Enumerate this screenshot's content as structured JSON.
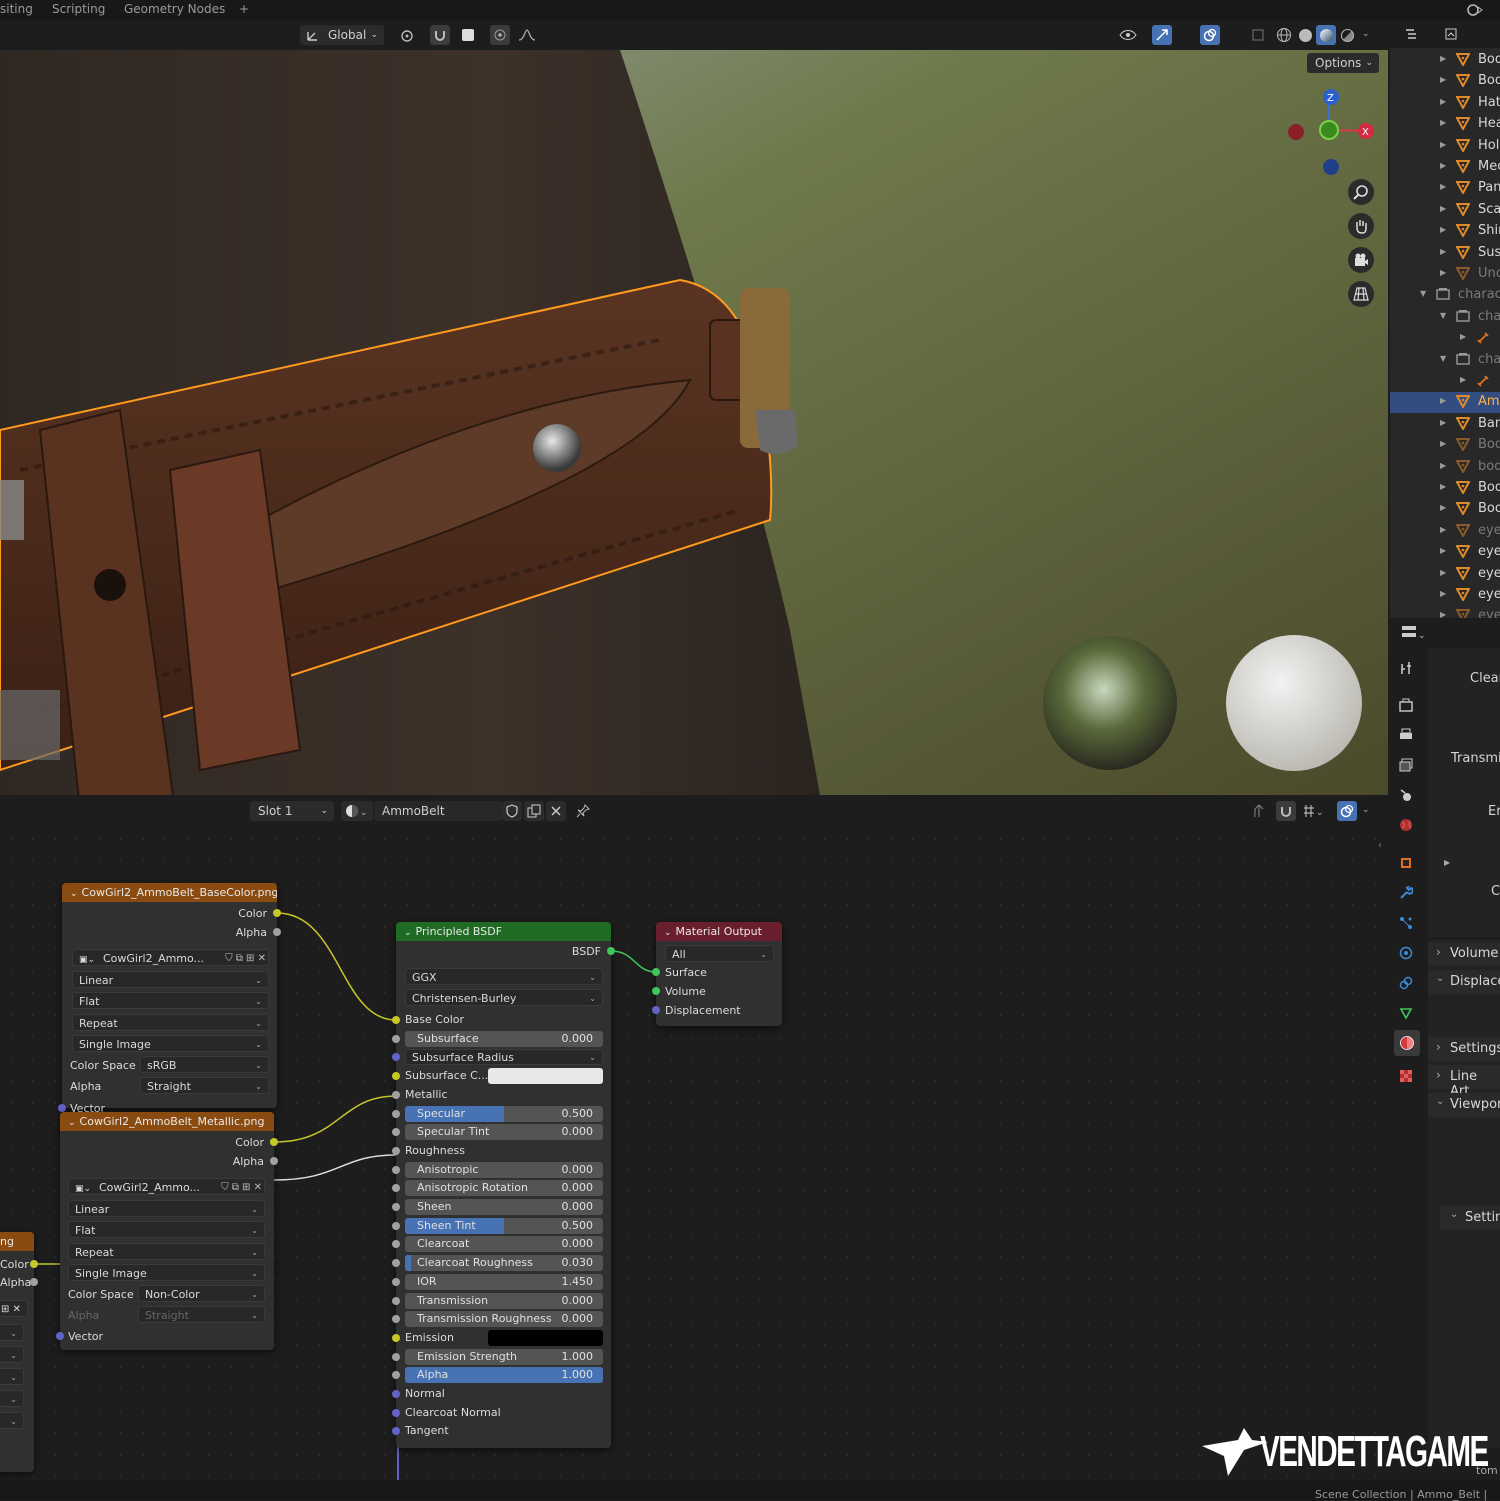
{
  "workspace_tabs": [
    "siting",
    "Scripting",
    "Geometry Nodes",
    "+"
  ],
  "viewport_header": {
    "orientation": "Global",
    "options_label": "Options"
  },
  "outliner": {
    "items": [
      {
        "label": "Bod",
        "type": "mesh"
      },
      {
        "label": "Boo",
        "type": "mesh"
      },
      {
        "label": "Hat",
        "type": "mesh"
      },
      {
        "label": "Hea",
        "type": "mesh"
      },
      {
        "label": "Hols",
        "type": "mesh"
      },
      {
        "label": "Mec",
        "type": "mesh"
      },
      {
        "label": "Pan",
        "type": "mesh"
      },
      {
        "label": "Sca",
        "type": "mesh"
      },
      {
        "label": "Shir",
        "type": "mesh"
      },
      {
        "label": "Sus",
        "type": "mesh"
      },
      {
        "label": "Unc",
        "type": "mesh-dim"
      },
      {
        "label": "charact",
        "type": "collection"
      },
      {
        "label": "cha",
        "type": "collection"
      },
      {
        "label": "",
        "type": "armature"
      },
      {
        "label": "cha",
        "type": "collection"
      },
      {
        "label": "",
        "type": "armature"
      },
      {
        "label": "Amr",
        "type": "mesh-selected"
      },
      {
        "label": "Ban",
        "type": "mesh"
      },
      {
        "label": "Bod",
        "type": "mesh-dim"
      },
      {
        "label": "bod",
        "type": "mesh-dim"
      },
      {
        "label": "Bod",
        "type": "mesh"
      },
      {
        "label": "Boo",
        "type": "mesh"
      },
      {
        "label": "eye",
        "type": "mesh-dim"
      },
      {
        "label": "eye",
        "type": "mesh"
      },
      {
        "label": "eye",
        "type": "mesh"
      },
      {
        "label": "eye",
        "type": "mesh"
      },
      {
        "label": "eye",
        "type": "mesh-dim"
      }
    ]
  },
  "properties": {
    "labels": [
      "Clear",
      "Transmis",
      "Er",
      "C"
    ],
    "panels": [
      "Volume",
      "Displace",
      "Settings",
      "Line Art",
      "Viewport",
      "Settin"
    ]
  },
  "node_editor_header": {
    "slot": "Slot 1",
    "material": "AmmoBelt"
  },
  "nodes": {
    "basecolor": {
      "title": "CowGirl2_AmmoBelt_BaseColor.png",
      "out_color": "Color",
      "out_alpha": "Alpha",
      "image": "CowGirl2_Ammo...",
      "interpolation": "Linear",
      "projection": "Flat",
      "extension": "Repeat",
      "source": "Single Image",
      "colorspace_label": "Color Space",
      "colorspace": "sRGB",
      "alpha_label": "Alpha",
      "alpha_mode": "Straight",
      "vector": "Vector"
    },
    "metallic": {
      "title": "CowGirl2_AmmoBelt_Metallic.png",
      "out_color": "Color",
      "out_alpha": "Alpha",
      "image": "CowGirl2_Ammo...",
      "interpolation": "Linear",
      "projection": "Flat",
      "extension": "Repeat",
      "source": "Single Image",
      "colorspace_label": "Color Space",
      "colorspace": "Non-Color",
      "alpha_label": "Alpha",
      "alpha_mode": "Straight",
      "vector": "Vector"
    },
    "partial": {
      "title": "ng",
      "out_color": "Color",
      "out_alpha": "Alpha"
    },
    "bsdf": {
      "title": "Principled BSDF",
      "output": "BSDF",
      "distribution": "GGX",
      "subsurface_method": "Christensen-Burley",
      "base_color": "Base Color",
      "subsurface_color": "Subsurface C...",
      "metallic": "Metallic",
      "roughness": "Roughness",
      "emission": "Emission",
      "normal": "Normal",
      "clearcoat_normal": "Clearcoat Normal",
      "tangent": "Tangent",
      "subsurface_radius": "Subsurface Radius",
      "fields": [
        {
          "label": "Subsurface",
          "value": "0.000",
          "fill": 0.0
        },
        {
          "label": "Specular",
          "value": "0.500",
          "fill": 0.5
        },
        {
          "label": "Specular Tint",
          "value": "0.000",
          "fill": 0.0
        },
        {
          "label": "Anisotropic",
          "value": "0.000",
          "fill": 0.0
        },
        {
          "label": "Anisotropic Rotation",
          "value": "0.000",
          "fill": 0.0
        },
        {
          "label": "Sheen",
          "value": "0.000",
          "fill": 0.0
        },
        {
          "label": "Sheen Tint",
          "value": "0.500",
          "fill": 0.5
        },
        {
          "label": "Clearcoat",
          "value": "0.000",
          "fill": 0.0
        },
        {
          "label": "Clearcoat Roughness",
          "value": "0.030",
          "fill": 0.03
        },
        {
          "label": "IOR",
          "value": "1.450",
          "fill": 0.0
        },
        {
          "label": "Transmission",
          "value": "0.000",
          "fill": 0.0
        },
        {
          "label": "Transmission Roughness",
          "value": "0.000",
          "fill": 0.0
        },
        {
          "label": "Emission Strength",
          "value": "1.000",
          "fill": 0.0
        },
        {
          "label": "Alpha",
          "value": "1.000",
          "fill": 1.0
        }
      ]
    },
    "output": {
      "title": "Material Output",
      "target": "All",
      "surface": "Surface",
      "volume": "Volume",
      "displacement": "Displacement"
    }
  },
  "watermark": "VENDETTAGAMES",
  "status": {
    "left_partial": "tom",
    "breadcrumb": "Scene Collection | Ammo_Belt |"
  },
  "colors": {
    "image_node_header": "#8a4b10",
    "bsdf_header": "#1f6b24",
    "output_header": "#6a1f2e",
    "selection": "#334d80",
    "accent_blue": "#4772b3",
    "socket_yellow": "#c7c729",
    "socket_gray": "#a1a1a1",
    "socket_blue": "#6363c7",
    "socket_green": "#3fc75b"
  }
}
